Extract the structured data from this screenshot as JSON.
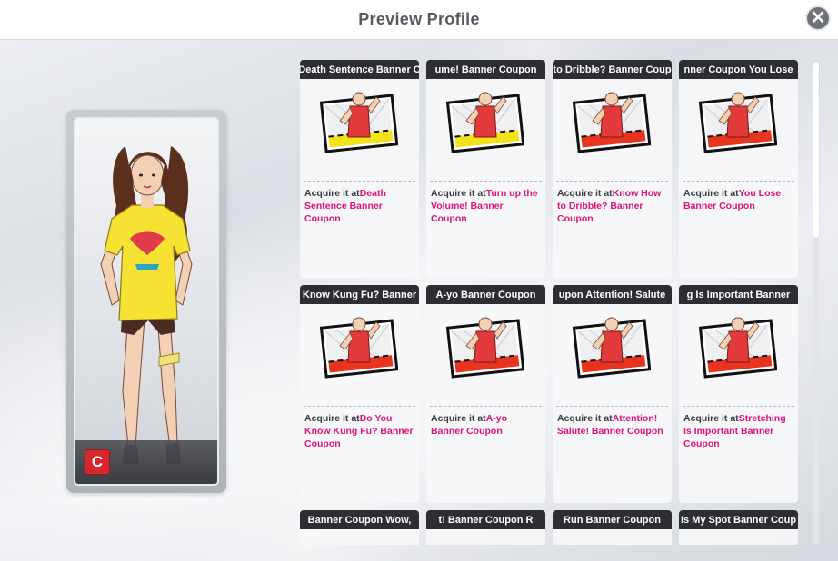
{
  "header": {
    "title": "Preview Profile",
    "close_icon": "close-icon"
  },
  "character": {
    "grade": "C"
  },
  "cards": [
    {
      "title": "Death Sentence Banner Coupon",
      "title_visible": "Death Sentence Banner C",
      "acquire_prefix": "Acquire it at",
      "source": "Death Sentence Banner Coupon",
      "tint": "#f2e21b"
    },
    {
      "title": "Turn up the Volume! Banner Coupon",
      "title_visible": "ume! Banner Coupon",
      "acquire_prefix": "Acquire it at",
      "source": "Turn up the Volume! Banner Coupon",
      "tint": "#f2e21b"
    },
    {
      "title": "Know How to Dribble? Banner Coupon",
      "title_visible": "to Dribble? Banner Coup",
      "acquire_prefix": "Acquire it at",
      "source": "Know How to Dribble? Banner Coupon",
      "tint": "#e8341f"
    },
    {
      "title": "You Lose Banner Coupon",
      "title_visible": "nner Coupon   You Lose",
      "acquire_prefix": "Acquire it at",
      "source": "You Lose Banner Coupon",
      "tint": "#e8341f"
    },
    {
      "title": "Do You Know Kung Fu? Banner Coupon",
      "title_visible": "Know Kung Fu? Banner",
      "acquire_prefix": "Acquire it at",
      "source": "Do You Know Kung Fu? Banner Coupon",
      "tint": "#e8341f"
    },
    {
      "title": "A-yo Banner Coupon",
      "title_visible": "A-yo Banner Coupon",
      "acquire_prefix": "Acquire it at",
      "source": "A-yo Banner Coupon",
      "tint": "#e8341f"
    },
    {
      "title": "Attention! Salute! Banner Coupon",
      "title_visible": "upon   Attention! Salute",
      "acquire_prefix": "Acquire it at",
      "source": "Attention! Salute! Banner Coupon",
      "tint": "#e8341f"
    },
    {
      "title": "Stretching Is Important Banner Coupon",
      "title_visible": "g Is Important Banner",
      "acquire_prefix": "Acquire it at",
      "source": "Stretching Is Important Banner Coupon",
      "tint": "#e8341f"
    },
    {
      "title": "Banner Coupon",
      "title_visible": "Banner Coupon   Wow,",
      "acquire_prefix": "",
      "source": "",
      "tint": "#e8341f"
    },
    {
      "title": "Banner Coupon",
      "title_visible": "t! Banner Coupon   R",
      "acquire_prefix": "",
      "source": "",
      "tint": "#e8341f"
    },
    {
      "title": "Run Banner Coupon",
      "title_visible": "Run Banner Coupon",
      "acquire_prefix": "",
      "source": "",
      "tint": "#e8341f"
    },
    {
      "title": "Is My Spot Banner Coupon",
      "title_visible": "Is My Spot Banner Coup",
      "acquire_prefix": "",
      "source": "",
      "tint": "#e8341f"
    }
  ],
  "colors": {
    "highlight": "#e0127a",
    "title_bar": "#2d2e32",
    "grade_badge": "#d8262d"
  }
}
